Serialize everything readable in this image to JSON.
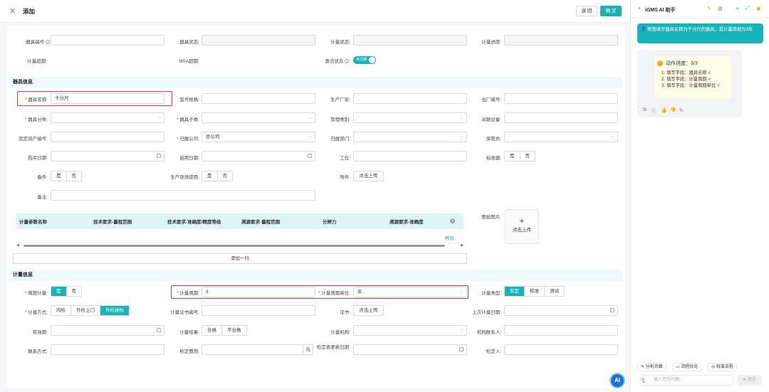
{
  "header": {
    "title": "添加",
    "back": "返 回",
    "confirm": "确 定"
  },
  "row1": {
    "tool_no": "器具编号",
    "tool_status": "器具状态:",
    "meter_status": "计量状态:",
    "meter_progress": "计量进度:"
  },
  "row2": {
    "overdue": "计量超期:",
    "msa_overdue": "MSA超期:",
    "activation": "激活状态",
    "activation_value": "未过期"
  },
  "sections": {
    "tool_info": "器具信息",
    "meter_info": "计量信息"
  },
  "tool": {
    "name_label": "器具名称:",
    "name_value": "千分尺",
    "model": "型号规格:",
    "manufacturer": "生产厂家:",
    "factory_no": "出厂编号:",
    "category": "器具分类:",
    "subcategory": "器具子类:",
    "mgmt_category": "管理类别:",
    "related_device": "关联设备:",
    "asset_no": "固定资产编号:",
    "company": "归属公司:",
    "company_value": "总公司",
    "dept": "归属部门:",
    "keeper": "保管员:",
    "buy_date": "购买日期:",
    "enable_date": "启用日期:",
    "station": "工位:",
    "standard": "标准器:",
    "spare": "备件:",
    "production_use": "生产现场使用:",
    "attachment": "附件:",
    "upload_btn": "点击上传",
    "remark": "备注:",
    "drawing": "图纸图片:",
    "yes": "是",
    "no": "否"
  },
  "table": {
    "headers": [
      "计量参数名称",
      "技术要求-量程范围",
      "技术要求-准确度/精度等级",
      "溯源要求-量程范围",
      "分辨力",
      "溯源要求-准确度"
    ],
    "remove": "移除",
    "add_row": "添加一行"
  },
  "meter": {
    "cycle_meter": "周期计量:",
    "cycle": "计量周期:",
    "cycle_value": "3",
    "cycle_unit": "计量周期单位:",
    "cycle_unit_value": "年",
    "meter_type": "计量类型:",
    "types": [
      "检定",
      "校准",
      "测试"
    ],
    "method": "计量方式:",
    "methods": [
      "内检",
      "外检上门",
      "外检送检"
    ],
    "cert_no": "计量证书编号:",
    "cert": "证书:",
    "last_date": "上次计量日期:",
    "valid": "有效期:",
    "result": "计量结果:",
    "results": [
      "合格",
      "不合格"
    ],
    "org": "计量机构:",
    "contact": "机构联系人:",
    "phone": "联系方式:",
    "fee": "检定费用:",
    "fee_unit": "元",
    "update_date": "检定表更新日期:",
    "verifier": "检定人:"
  },
  "assistant": {
    "title": "iGMS AI 助手",
    "user_msg": "帮我填写器具名称为千分尺的器具，其计量周期为3年",
    "progress_title": "动作进度：3/3",
    "steps": [
      "1. 填写字段：器具名称 √",
      "2. 填写字段：计量周期 √",
      "3. 填写字段：计量周期单位 √"
    ],
    "chips": [
      "分析页面",
      "流程优化",
      "校准流程"
    ],
    "input_placeholder": "输入您的问题...",
    "send": "发送",
    "fab": "AI"
  },
  "colors": {
    "accent": "#17b3b6",
    "highlight": "#d9363e"
  }
}
